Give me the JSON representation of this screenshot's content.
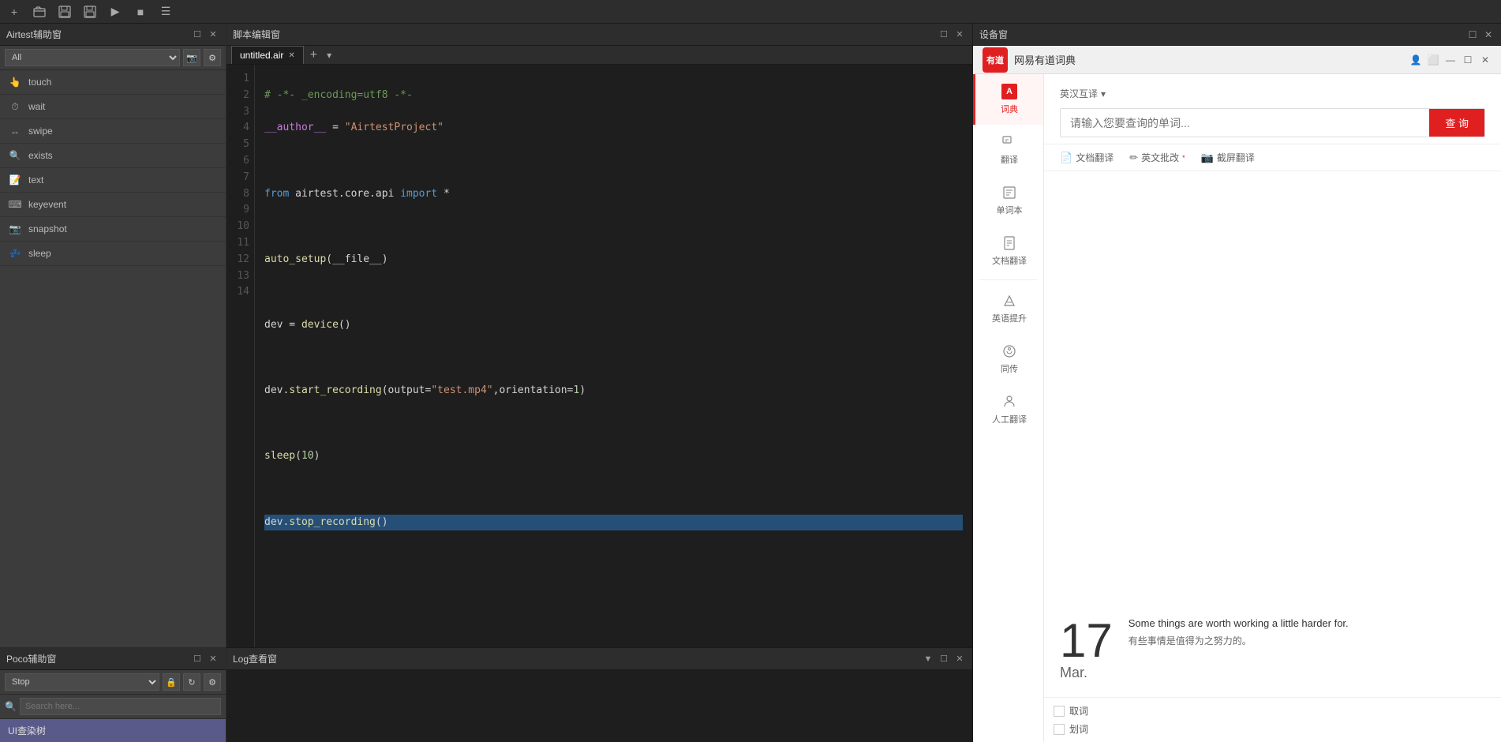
{
  "topToolbar": {
    "buttons": [
      {
        "name": "add",
        "icon": "+"
      },
      {
        "name": "open",
        "icon": "📂"
      },
      {
        "name": "save",
        "icon": "💾"
      },
      {
        "name": "save-all",
        "icon": "💾"
      },
      {
        "name": "run",
        "icon": "▶"
      },
      {
        "name": "stop",
        "icon": "■"
      },
      {
        "name": "log",
        "icon": "☰"
      }
    ]
  },
  "airtestPanel": {
    "title": "Airtest辅助窗",
    "filterPlaceholder": "All",
    "filterOptions": [
      "All",
      "touch",
      "wait",
      "swipe",
      "exists",
      "text",
      "keyevent",
      "snapshot",
      "sleep"
    ],
    "items": [
      {
        "label": "touch",
        "icon": "👆"
      },
      {
        "label": "wait",
        "icon": "⏱"
      },
      {
        "label": "swipe",
        "icon": "↔"
      },
      {
        "label": "exists",
        "icon": "🔍"
      },
      {
        "label": "text",
        "icon": "📝"
      },
      {
        "label": "keyevent",
        "icon": "⌨"
      },
      {
        "label": "snapshot",
        "icon": "📷"
      },
      {
        "label": "sleep",
        "icon": "💤"
      }
    ]
  },
  "pocoPanel": {
    "title": "Poco辅助窗",
    "stopLabel": "Stop",
    "searchPlaceholder": "Search here...",
    "treeItem": "UI查染树"
  },
  "scriptEditor": {
    "title": "脚本编辑窗",
    "tabName": "untitled.air",
    "lines": [
      {
        "num": 1,
        "code": "# -*- _encoding=utf8 -*-",
        "classes": [
          "kw-comment"
        ]
      },
      {
        "num": 2,
        "code": "__author__ = \"AirtestProject\"",
        "classes": [
          "kw-string"
        ]
      },
      {
        "num": 3,
        "code": ""
      },
      {
        "num": 4,
        "code": "from airtest.core.api import *",
        "classes": [
          "kw-keyword"
        ]
      },
      {
        "num": 5,
        "code": ""
      },
      {
        "num": 6,
        "code": "auto_setup(__file__)"
      },
      {
        "num": 7,
        "code": ""
      },
      {
        "num": 8,
        "code": "dev = device()"
      },
      {
        "num": 9,
        "code": ""
      },
      {
        "num": 10,
        "code": "dev.start_recording(output=\"test.mp4\",orientation=1)",
        "classes": [
          "kw-function"
        ]
      },
      {
        "num": 11,
        "code": ""
      },
      {
        "num": 12,
        "code": "sleep(10)"
      },
      {
        "num": 13,
        "code": ""
      },
      {
        "num": 14,
        "code": "dev.stop_recording()",
        "classes": [
          "kw-selected"
        ]
      }
    ]
  },
  "logViewer": {
    "title": "Log查看窗"
  },
  "devicePanel": {
    "title": "设备窗"
  },
  "youdao": {
    "logoText": "有道",
    "appName": "网易有道词典",
    "langSwitch": "英汉互译",
    "searchPlaceholder": "请输入您要查询的单词...",
    "searchBtn": "查 询",
    "tools": [
      {
        "label": "文档翻译",
        "icon": "📄"
      },
      {
        "label": "英文批改",
        "icon": "✏",
        "superscript": "*"
      },
      {
        "label": "截屏翻译",
        "icon": "📷"
      }
    ],
    "navItems": [
      {
        "label": "词典",
        "icon": "A",
        "active": true
      },
      {
        "label": "翻译",
        "icon": "⬜"
      },
      {
        "label": "单词本",
        "icon": "📖"
      },
      {
        "label": "文档翻译",
        "icon": "📄"
      },
      {
        "label": "英语提升",
        "icon": "▶"
      },
      {
        "label": "同传",
        "icon": "⚙"
      },
      {
        "label": "人工翻译",
        "icon": "🎙"
      }
    ],
    "dateNum": "17",
    "dateMonth": "Mar.",
    "quoteEn": "Some things are worth working a little harder for.",
    "quoteZh": "有些事情是值得为之努力的。",
    "bottomOptions": [
      {
        "label": "取词"
      },
      {
        "label": "划词"
      }
    ],
    "winControls": {
      "profile": "👤",
      "resize": "⬜",
      "minimize": "—",
      "maximize": "☐",
      "close": "✕"
    }
  }
}
